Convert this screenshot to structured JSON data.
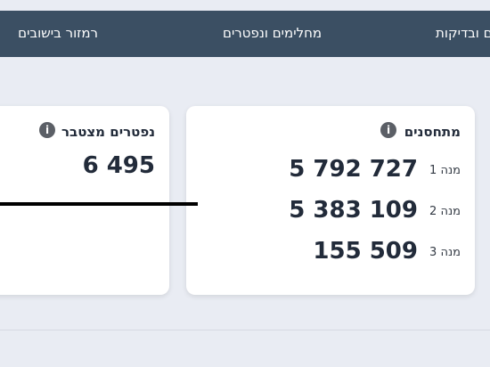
{
  "nav": {
    "item_right": "נים ובדיקות",
    "item_middle": "מחלימים ונפטרים",
    "item_left": "רמזור בישובים"
  },
  "vaccinated_card": {
    "title": "מתחסנים",
    "info_icon": "info-icon",
    "doses": [
      {
        "label": "מנה 1",
        "value": "5 792 727"
      },
      {
        "label": "מנה 2",
        "value": "5 383 109"
      },
      {
        "label": "מנה 3",
        "value": "155 509"
      }
    ]
  },
  "deaths_card": {
    "title": "נפטרים מצטבר",
    "info_icon": "info-icon",
    "value": "6 495"
  },
  "colors": {
    "topbar": "#3b4f63",
    "background": "#e9ecf3",
    "card": "#ffffff",
    "text_dark": "#222b3a"
  }
}
